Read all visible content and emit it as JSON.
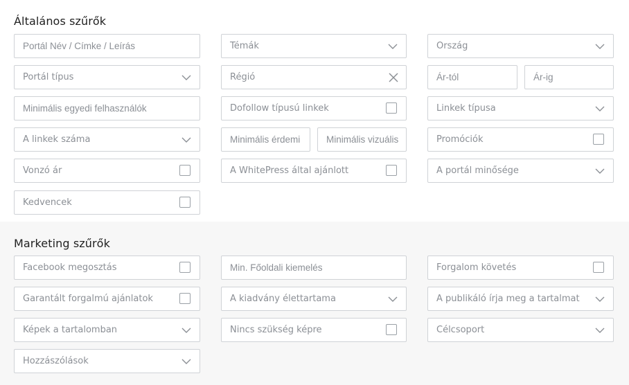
{
  "general": {
    "title": "Általános szűrők",
    "portal_search_placeholder": "Portál Név / Címke / Leírás",
    "topics": "Témák",
    "country": "Ország",
    "portal_type": "Portál típus",
    "region": "Régió",
    "price_from": "Ár-tól",
    "price_to": "Ár-ig",
    "min_unique_users": "Minimális egyedi felhasználók",
    "dofollow_links": "Dofollow típusú linkek",
    "link_type": "Linkek típusa",
    "link_count": "A linkek száma",
    "min_merit": "Minimális érdemi",
    "min_visual": "Minimális vizuális",
    "promotions": "Promóciók",
    "attractive_price": "Vonzó ár",
    "recommended_by_whitepress": "A WhitePress által ajánlott",
    "portal_quality": "A portál minősége",
    "favorites": "Kedvencek"
  },
  "marketing": {
    "title": "Marketing szűrők",
    "facebook_share": "Facebook megosztás",
    "min_homepage_highlight": "Min. Főoldali kiemelés",
    "traffic_tracking": "Forgalom követés",
    "guaranteed_traffic_offers": "Garantált forgalmú ajánlatok",
    "publication_lifetime": "A kiadvány élettartama",
    "publisher_writes_content": "A publikáló írja meg a tartalmat",
    "images_in_content": "Képek a tartalomban",
    "no_image_needed": "Nincs szükség képre",
    "target_group": "Célcsoport",
    "comments": "Hozzászólások"
  },
  "icons": {
    "dropdown": "chevron-down-icon",
    "clear": "close-icon",
    "checkbox": "checkbox-unchecked"
  }
}
